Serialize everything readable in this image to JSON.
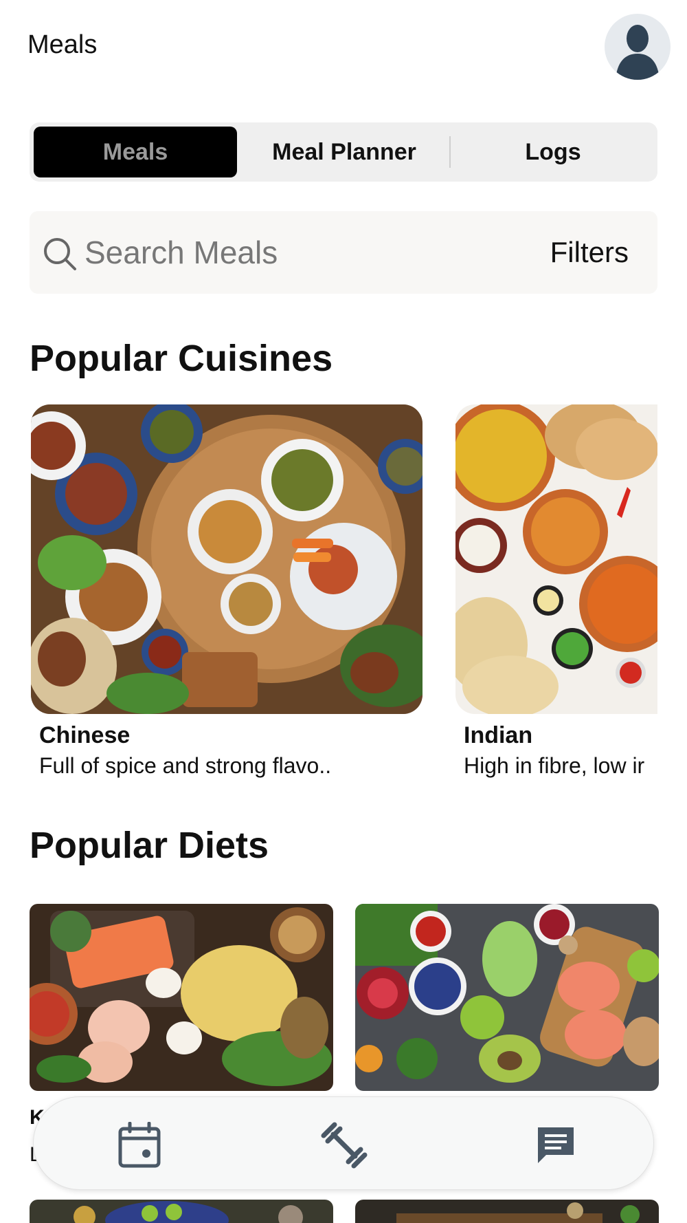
{
  "header": {
    "title": "Meals"
  },
  "tabs": [
    {
      "label": "Meals"
    },
    {
      "label": "Meal Planner"
    },
    {
      "label": "Logs"
    }
  ],
  "search": {
    "placeholder": "Search Meals",
    "filters_label": "Filters"
  },
  "sections": {
    "cuisines_title": "Popular Cuisines",
    "diets_title": "Popular Diets"
  },
  "cuisines": [
    {
      "name": "Chinese",
      "description": "Full of spice and strong flavo.."
    },
    {
      "name": "Indian",
      "description": "High in fibre, low ir"
    }
  ],
  "diets": [
    {
      "name": "K",
      "description": "L"
    }
  ],
  "bottom_nav": {
    "items": [
      {
        "icon": "calendar-icon"
      },
      {
        "icon": "dumbbell-icon"
      },
      {
        "icon": "chat-icon"
      }
    ]
  },
  "colors": {
    "active_tab_bg": "#000000",
    "active_tab_text": "#9a9a9a",
    "icon_color": "#4a5866",
    "avatar_fg": "#2f4254"
  }
}
